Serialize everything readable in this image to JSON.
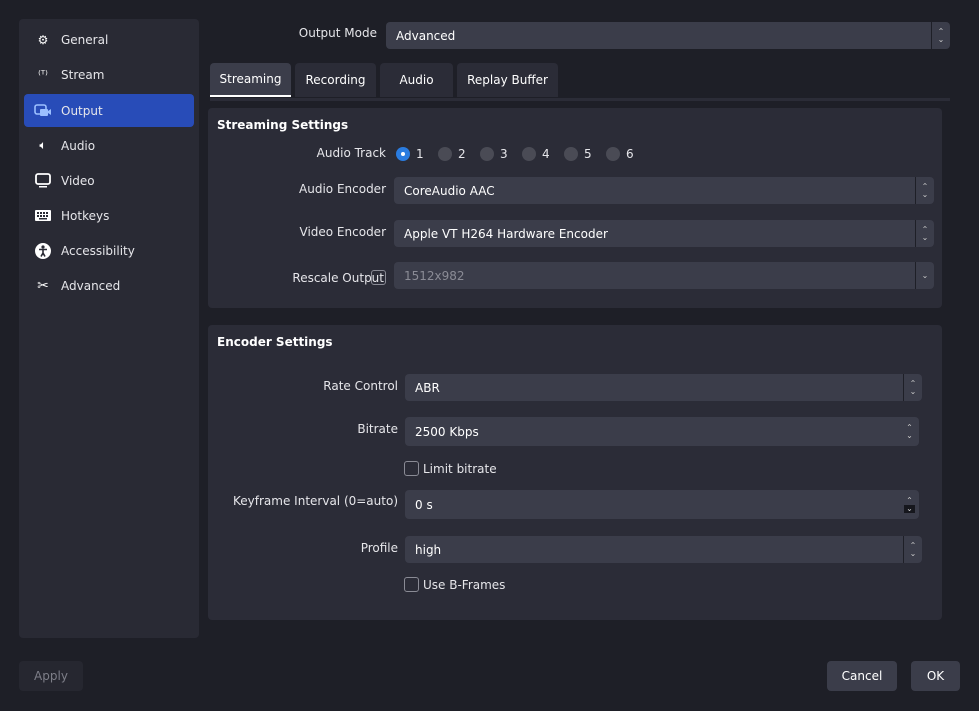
{
  "sidebar": {
    "items": [
      {
        "label": "General",
        "icon": "gear-icon"
      },
      {
        "label": "Stream",
        "icon": "antenna-icon"
      },
      {
        "label": "Output",
        "icon": "output-icon",
        "active": true
      },
      {
        "label": "Audio",
        "icon": "speaker-icon"
      },
      {
        "label": "Video",
        "icon": "monitor-icon"
      },
      {
        "label": "Hotkeys",
        "icon": "keyboard-icon"
      },
      {
        "label": "Accessibility",
        "icon": "accessibility-icon"
      },
      {
        "label": "Advanced",
        "icon": "tools-icon"
      }
    ]
  },
  "output_mode": {
    "label": "Output Mode",
    "value": "Advanced"
  },
  "tabs": [
    {
      "label": "Streaming",
      "active": true
    },
    {
      "label": "Recording"
    },
    {
      "label": "Audio"
    },
    {
      "label": "Replay Buffer"
    }
  ],
  "streaming": {
    "title": "Streaming Settings",
    "audio_track_label": "Audio Track",
    "tracks": [
      "1",
      "2",
      "3",
      "4",
      "5",
      "6"
    ],
    "selected_track": "1",
    "audio_encoder_label": "Audio Encoder",
    "audio_encoder": "CoreAudio AAC",
    "video_encoder_label": "Video Encoder",
    "video_encoder": "Apple VT H264 Hardware Encoder",
    "rescale_label": "Rescale Output",
    "rescale_checked": false,
    "rescale_value": "1512x982"
  },
  "encoder": {
    "title": "Encoder Settings",
    "rate_control_label": "Rate Control",
    "rate_control": "ABR",
    "bitrate_label": "Bitrate",
    "bitrate": "2500 Kbps",
    "limit_bitrate_label": "Limit bitrate",
    "limit_bitrate": false,
    "keyframe_label": "Keyframe Interval (0=auto)",
    "keyframe": "0 s",
    "profile_label": "Profile",
    "profile": "high",
    "bframes_label": "Use B-Frames",
    "bframes": false
  },
  "buttons": {
    "apply": "Apply",
    "cancel": "Cancel",
    "ok": "OK"
  },
  "colors": {
    "accent": "#284cb8",
    "radio": "#2a7ce0"
  }
}
